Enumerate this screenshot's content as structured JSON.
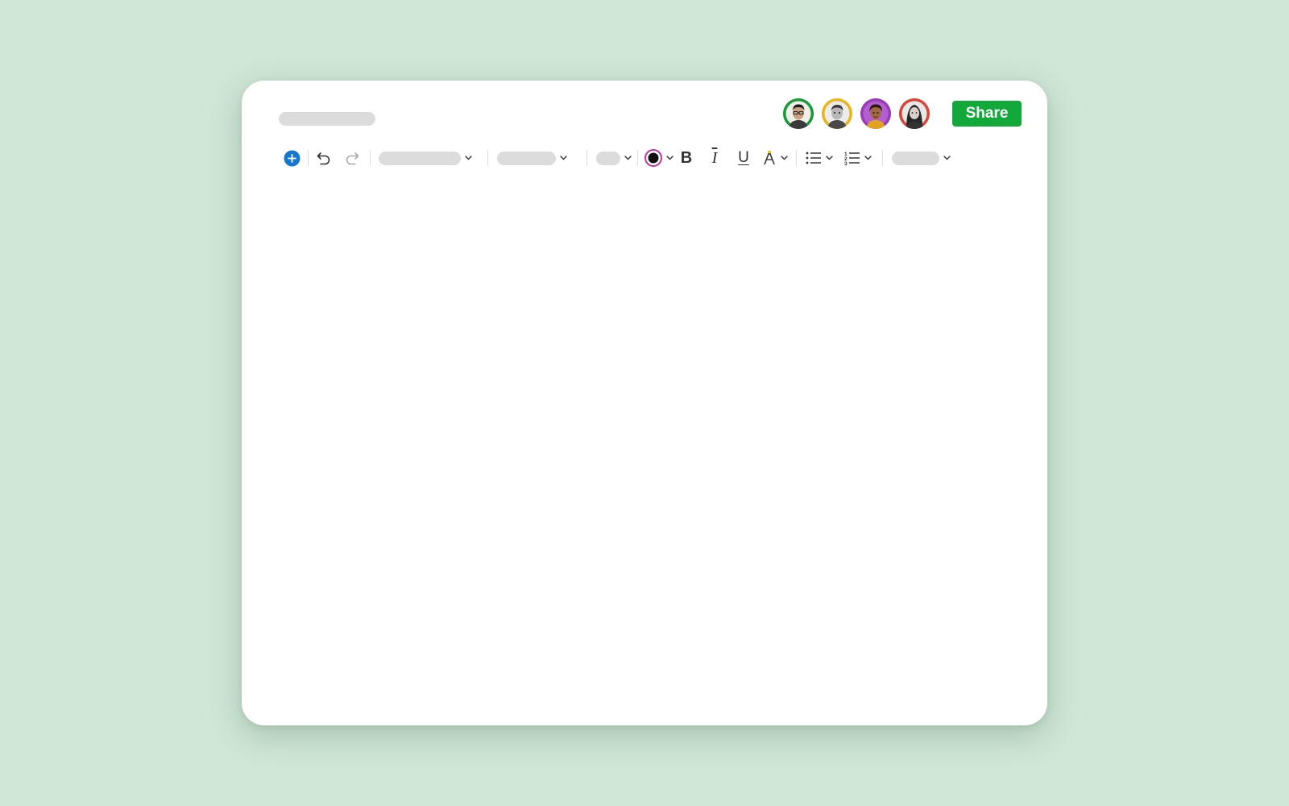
{
  "document": {
    "share_label": "Share"
  },
  "collaborators": [
    {
      "name": "avatar-1",
      "ring_color": "#1a9a3a"
    },
    {
      "name": "avatar-2",
      "ring_color": "#e8b51a"
    },
    {
      "name": "avatar-3",
      "ring_color": "#9a3ab8"
    },
    {
      "name": "avatar-4",
      "ring_color": "#d8463a"
    }
  ],
  "colors": {
    "background": "#d0e6d6",
    "share_button": "#12a83a",
    "add_button": "#1577cf",
    "text_color_ring": "#c0369a",
    "highlight_accent": "#f2c01d",
    "skeleton": "#dcdcdc"
  },
  "toolbar": {
    "icons": [
      "plus-icon",
      "undo-icon",
      "redo-icon",
      "chevron-down-icon",
      "text-color-icon",
      "bold-icon",
      "italic-icon",
      "underline-icon",
      "highlight-icon",
      "bullet-list-icon",
      "numbered-list-icon"
    ],
    "bold_glyph": "B",
    "italic_glyph": "I",
    "underline_glyph": "U"
  }
}
